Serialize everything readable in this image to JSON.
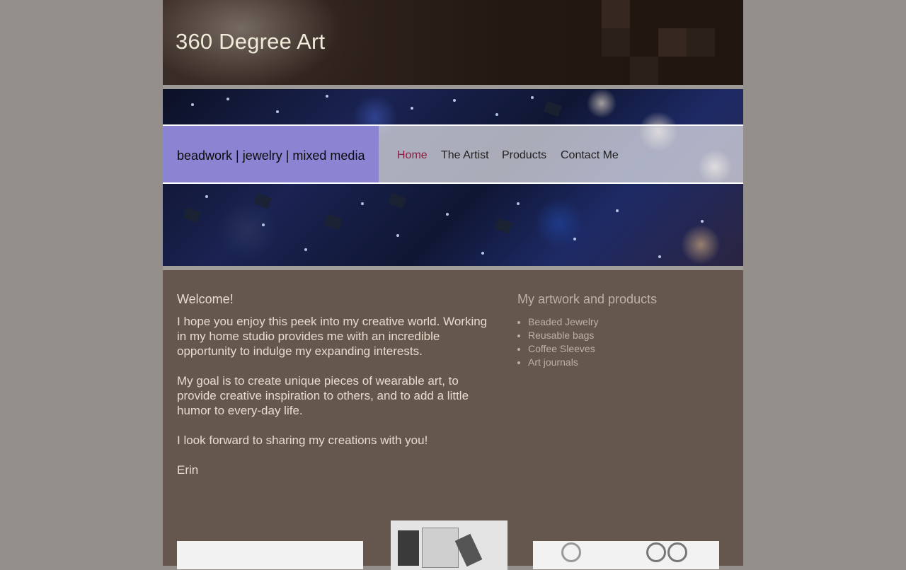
{
  "header": {
    "site_title": "360 Degree Art"
  },
  "navbar": {
    "tagline": "beadwork | jewelry | mixed media",
    "items": [
      {
        "label": "Home",
        "active": true
      },
      {
        "label": "The Artist",
        "active": false
      },
      {
        "label": "Products",
        "active": false
      },
      {
        "label": "Contact Me",
        "active": false
      }
    ]
  },
  "main": {
    "heading": "Welcome!",
    "paragraphs": [
      "I hope you enjoy this peek into my creative world. Working in my home studio provides me with an incredible opportunity to indulge my expanding interests.",
      "My goal is to create unique pieces of wearable art, to provide creative inspiration to others, and to add a little humor to every-day life.",
      "I look forward to sharing my creations with you!",
      "Erin"
    ]
  },
  "sidebar": {
    "heading": "My artwork and products",
    "items": [
      "Beaded Jewelry",
      "Reusable bags",
      "Coffee Sleeves",
      "Art journals"
    ]
  },
  "colors": {
    "page_bg": "#948f8a",
    "content_bg": "#65574e",
    "tagline_bg": "#8b84d2",
    "nav_active": "#8a1c3e",
    "title_text": "#f1ecd9"
  }
}
